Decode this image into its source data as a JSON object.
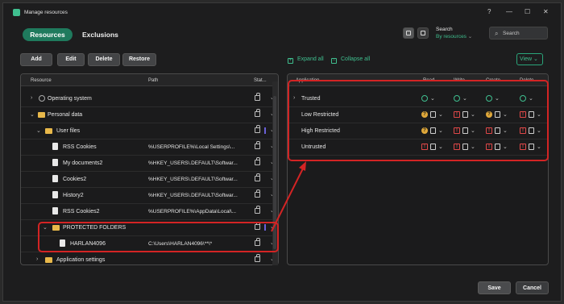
{
  "window": {
    "title": "Manage resources",
    "controls": {
      "help": "?",
      "minimize": "—",
      "maximize": "☐",
      "close": "✕"
    }
  },
  "tabs": [
    {
      "label": "Resources",
      "active": true
    },
    {
      "label": "Exclusions",
      "active": false
    }
  ],
  "search": {
    "label": "Search",
    "scope": "By resources",
    "placeholder": "Search"
  },
  "toolbar": {
    "add": "Add",
    "edit": "Edit",
    "delete": "Delete",
    "restore": "Restore",
    "expand_all": "Expand all",
    "collapse_all": "Collapse all",
    "view": "View"
  },
  "left_table": {
    "headers": {
      "resource": "Resource",
      "path": "Path",
      "status": "Stat..."
    },
    "rows": [
      {
        "label": "Operating system",
        "path": ""
      },
      {
        "label": "Personal data",
        "path": ""
      },
      {
        "label": "User files",
        "path": ""
      },
      {
        "label": "RSS Cookies",
        "path": "%USERPROFILE%\\Local Settings\\..."
      },
      {
        "label": "My documents2",
        "path": "%HKEY_USERS\\.DEFAULT\\Softwar..."
      },
      {
        "label": "Cookies2",
        "path": "%HKEY_USERS\\.DEFAULT\\Softwar..."
      },
      {
        "label": "History2",
        "path": "%HKEY_USERS\\.DEFAULT\\Softwar..."
      },
      {
        "label": "RSS Cookies2",
        "path": "%USERPROFILE%\\AppData\\Local\\..."
      },
      {
        "label": "PROTECTED FOLDERS",
        "path": ""
      },
      {
        "label": "HARLAN4096",
        "path": "C:\\Users\\HARLAN4096\\**\\*"
      },
      {
        "label": "Application settings",
        "path": ""
      }
    ]
  },
  "right_table": {
    "headers": {
      "application": "Application",
      "read": "Read",
      "write": "Write",
      "create": "Create",
      "delete": "Delete"
    },
    "rows": [
      {
        "label": "Trusted",
        "read": "allow",
        "write": "allow",
        "create": "allow",
        "delete": "allow"
      },
      {
        "label": "Low Restricted",
        "read": "ask",
        "write": "deny",
        "create": "ask",
        "delete": "deny"
      },
      {
        "label": "High Restricted",
        "read": "ask",
        "write": "deny",
        "create": "deny",
        "delete": "deny"
      },
      {
        "label": "Untrusted",
        "read": "deny",
        "write": "deny",
        "create": "deny",
        "delete": "deny"
      }
    ]
  },
  "footer": {
    "save": "Save",
    "cancel": "Cancel"
  },
  "colors": {
    "accent": "#1f7a5d",
    "accent_text": "#3fbf8f",
    "highlight": "#d32424",
    "warning": "#e0a83a",
    "danger": "#e04848"
  }
}
